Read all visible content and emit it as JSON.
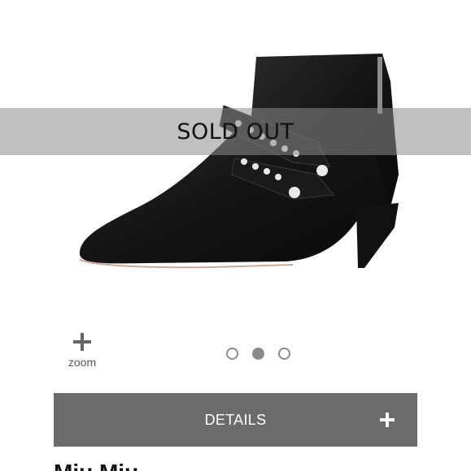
{
  "product": {
    "image_alt": "Black leather pointed-toe kitten-heel ankle bootie with pearl studded straps"
  },
  "banner": {
    "sold_out": "SOLD OUT"
  },
  "zoom": {
    "label": "zoom",
    "icon": "plus-icon"
  },
  "pager": {
    "count": 3,
    "active_index": 1
  },
  "details": {
    "label": "DETAILS",
    "icon": "plus-icon"
  },
  "title_peek": {
    "text": "Miu Miu"
  },
  "colors": {
    "details_bg": "#6b6b6b",
    "banner_overlay": "rgba(140,140,140,0.55)",
    "dot": "#8a8a8a"
  }
}
